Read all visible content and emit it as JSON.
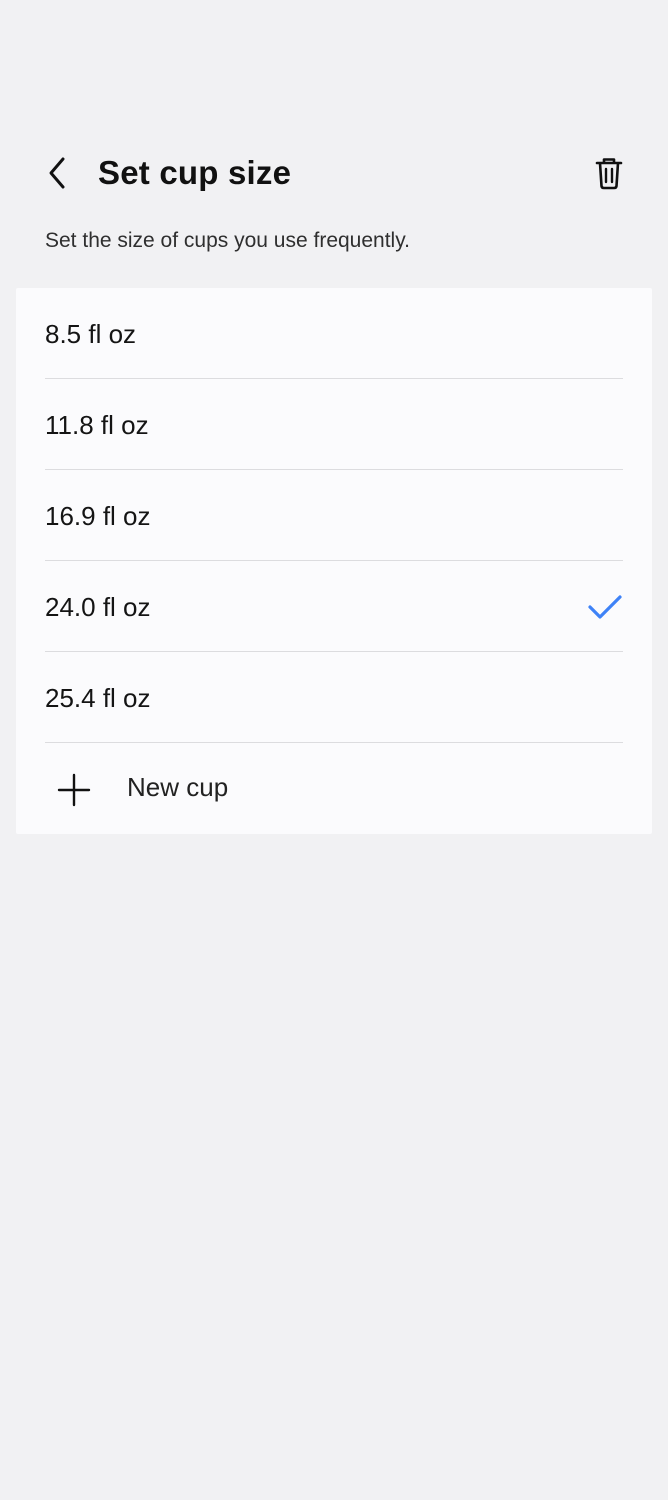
{
  "header": {
    "title": "Set cup size",
    "back_icon": "back-chevron-icon",
    "delete_icon": "trash-icon"
  },
  "description": "Set the size of cups you use frequently.",
  "cups": [
    {
      "label": "8.5 fl oz",
      "selected": false
    },
    {
      "label": "11.8 fl oz",
      "selected": false
    },
    {
      "label": "16.9 fl oz",
      "selected": false
    },
    {
      "label": "24.0 fl oz",
      "selected": true
    },
    {
      "label": "25.4 fl oz",
      "selected": false
    }
  ],
  "new_cup": {
    "label": "New cup",
    "icon": "plus-icon"
  },
  "colors": {
    "accent": "#3e82f7",
    "background": "#f1f1f3",
    "card": "#fbfbfd"
  }
}
